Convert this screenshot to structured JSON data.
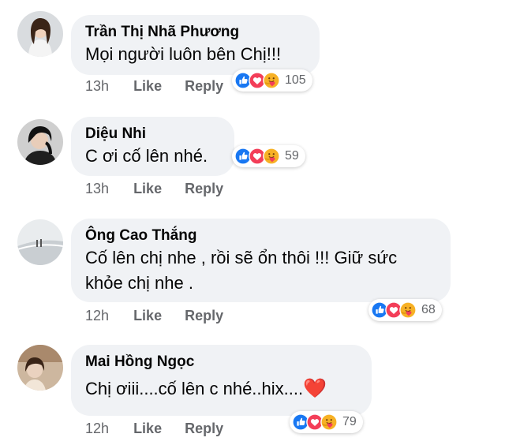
{
  "comments": [
    {
      "author": "Trần Thị Nhã Phương",
      "text": "Mọi người luôn bên Chị!!!",
      "time": "13h",
      "like_label": "Like",
      "reply_label": "Reply",
      "reaction_count": "105",
      "reaction_icons": [
        "like-icon",
        "love-icon",
        "care-icon"
      ]
    },
    {
      "author": "Diệu Nhi",
      "text": "C ơi cố lên nhé.",
      "time": "13h",
      "like_label": "Like",
      "reply_label": "Reply",
      "reaction_count": "59",
      "reaction_icons": [
        "like-icon",
        "love-icon",
        "care-icon"
      ]
    },
    {
      "author": "Ông Cao Thắng",
      "text_line1": "Cố lên chị nhe , rồi sẽ ổn thôi !!! Giữ sức",
      "text_line2": "khỏe chị nhe .",
      "time": "12h",
      "like_label": "Like",
      "reply_label": "Reply",
      "reaction_count": "68",
      "reaction_icons": [
        "like-icon",
        "love-icon",
        "care-icon"
      ]
    },
    {
      "author": "Mai Hồng Ngọc",
      "text": "Chị ơiii....cố lên c nhé..hix....",
      "emoji": "❤️",
      "time": "12h",
      "like_label": "Like",
      "reply_label": "Reply",
      "reaction_count": "79",
      "reaction_icons": [
        "like-icon",
        "love-icon",
        "care-icon"
      ]
    }
  ],
  "colors": {
    "bubble": "#f0f2f5",
    "like": "#1877f2",
    "love": "#f33e58",
    "care": "#f7b125",
    "meta": "#65676b"
  }
}
